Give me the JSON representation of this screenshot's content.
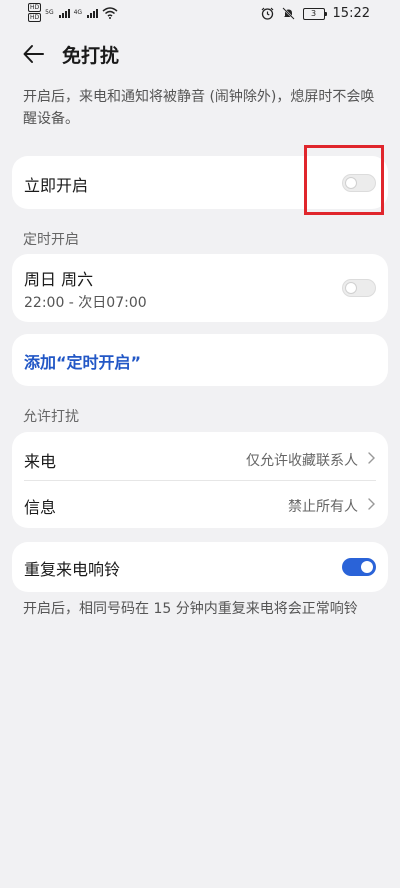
{
  "status_bar": {
    "time": "15:22",
    "battery": "3",
    "sim_badge": "HD",
    "net1": "5G",
    "net2": "4G"
  },
  "header": {
    "title": "免打扰"
  },
  "intro": "开启后，来电和通知将被静音 (闹钟除外)，熄屏时不会唤醒设备。",
  "immediate": {
    "label": "立即开启",
    "enabled": false
  },
  "schedule": {
    "section_label": "定时开启",
    "days": "周日 周六",
    "time_range": "22:00 - 次日07:00",
    "enabled": false,
    "add_label": "添加“定时开启”"
  },
  "allow": {
    "section_label": "允许打扰",
    "rows": [
      {
        "label": "来电",
        "value": "仅允许收藏联系人"
      },
      {
        "label": "信息",
        "value": "禁止所有人"
      }
    ]
  },
  "repeat": {
    "label": "重复来电响铃",
    "enabled": true,
    "description": "开启后，相同号码在 15 分钟内重复来电将会正常响铃"
  },
  "colors": {
    "accent": "#2257c6",
    "toggle_on": "#2a63d8",
    "highlight": "#e0262c",
    "background": "#f1f1f3"
  }
}
